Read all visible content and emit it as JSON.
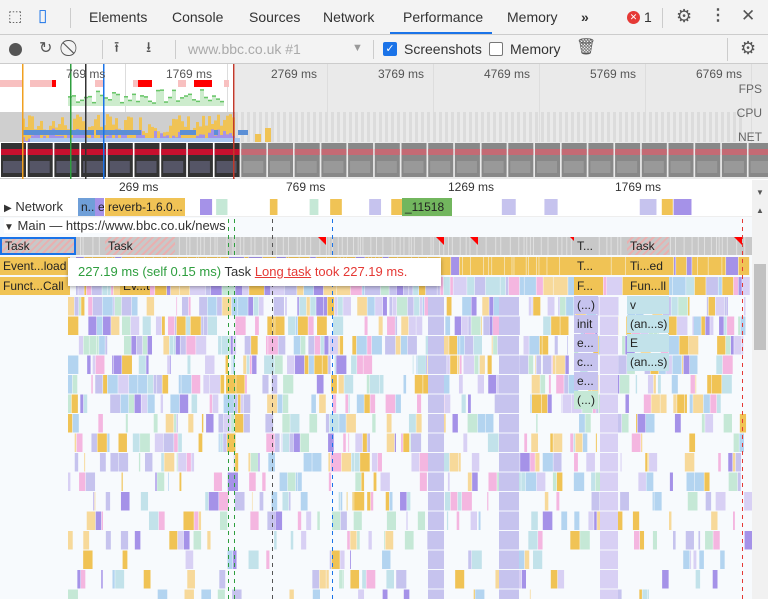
{
  "tabs": [
    {
      "label": "Elements"
    },
    {
      "label": "Console"
    },
    {
      "label": "Sources"
    },
    {
      "label": "Network"
    },
    {
      "label": "Performance",
      "active": true
    },
    {
      "label": "Memory"
    }
  ],
  "more_tabs": "»",
  "error_count": "1",
  "toolbar": {
    "recording_select": "www.bbc.co.uk #1",
    "screenshots_label": "Screenshots",
    "screenshots_checked": true,
    "memory_label": "Memory",
    "memory_checked": false
  },
  "overview": {
    "ticks": [
      "769 ms",
      "1769 ms",
      "2769 ms",
      "3769 ms",
      "4769 ms",
      "5769 ms",
      "6769 ms"
    ],
    "rows": [
      "FPS",
      "CPU",
      "NET"
    ]
  },
  "ruler": {
    "ticks": [
      "269 ms",
      "769 ms",
      "1269 ms",
      "1769 ms"
    ]
  },
  "network_track": {
    "label": "Network",
    "items": [
      "n...",
      "e",
      "reverb-1.6.0...",
      "_11518"
    ]
  },
  "main_track": {
    "label": "Main — https://www.bbc.co.uk/news"
  },
  "flame": {
    "row0": [
      "Task",
      "Task",
      "T...",
      "Task"
    ],
    "row1": [
      "Event...load",
      "T...",
      "Ti...ed"
    ],
    "row2": [
      "Funct...Call",
      "Ev...t",
      "F...",
      "Fun...ll"
    ],
    "col_a": [
      "(...)",
      "init",
      "e...",
      "c...",
      "e...",
      "(...)"
    ],
    "col_b": [
      "v",
      "(an...s)",
      "E",
      "(an...s)"
    ]
  },
  "tooltip": {
    "time": "227.19 ms (self 0.15 ms)",
    "name": "Task",
    "link": "Long task",
    "message": "took 227.19 ms."
  },
  "colors": {
    "accent": "#1a73e8",
    "scripting": "#f0c355",
    "rendering": "#a592e8",
    "idle": "#c8c8c8",
    "long_task": "#e8392c",
    "fps": "#68c568"
  }
}
